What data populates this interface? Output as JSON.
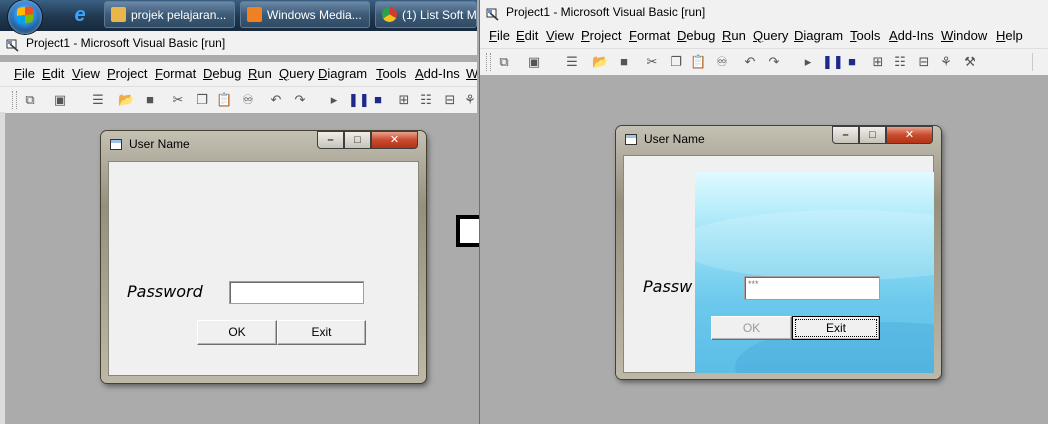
{
  "taskbar": {
    "buttons": [
      {
        "label": "projek pelajaran...",
        "icon": "folder-icon",
        "color": "#e8b64a"
      },
      {
        "label": "Windows Media...",
        "icon": "media-player-icon",
        "color": "#f08020"
      },
      {
        "label": "(1) List Soft M",
        "icon": "chrome-icon",
        "color": "#d33b2c"
      }
    ]
  },
  "left_ide": {
    "title": "Project1 - Microsoft Visual Basic [run]",
    "menu": [
      "File",
      "Edit",
      "View",
      "Project",
      "Format",
      "Debug",
      "Run",
      "Query",
      "Diagram",
      "Tools",
      "Add-Ins",
      "W"
    ]
  },
  "right_ide": {
    "title": "Project1 - Microsoft Visual Basic [run]",
    "menu": [
      "File",
      "Edit",
      "View",
      "Project",
      "Format",
      "Debug",
      "Run",
      "Query",
      "Diagram",
      "Tools",
      "Add-Ins",
      "Window",
      "Help"
    ]
  },
  "form_before": {
    "title": "User Name",
    "password_label": "Password",
    "password_value": "",
    "ok_label": "OK",
    "exit_label": "Exit"
  },
  "form_after": {
    "title": "User Name",
    "password_label": "Passw",
    "password_value": "***",
    "ok_label": "OK",
    "exit_label": "Exit"
  },
  "icons": {
    "caption_min": "minimize-icon",
    "caption_max": "maximize-icon",
    "caption_close": "close-icon",
    "transition": "right-arrow-icon"
  },
  "colors": {
    "desktop_gray": "#ababab",
    "close_red": "#c94a2e",
    "sky_blue": "#6cc9ec"
  }
}
